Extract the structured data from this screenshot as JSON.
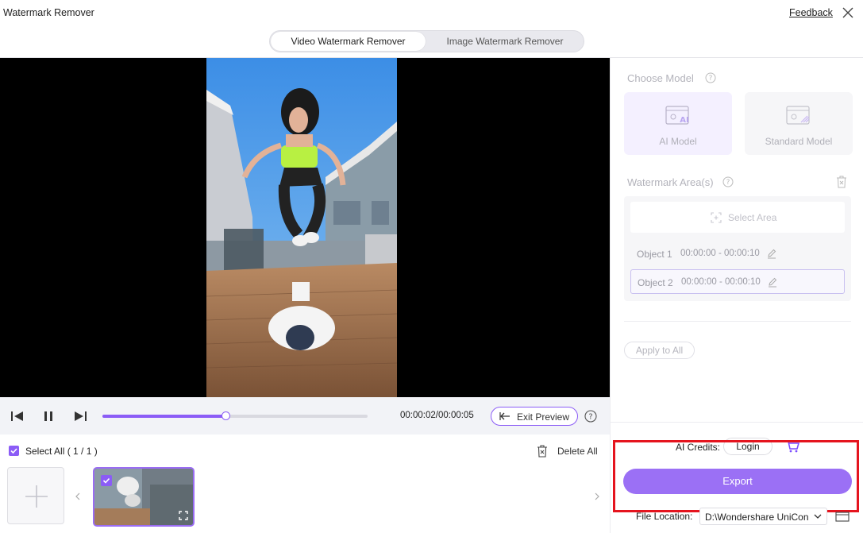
{
  "window": {
    "title": "Watermark Remover",
    "feedback_label": "Feedback"
  },
  "mode_tabs": [
    {
      "label": "Video Watermark Remover",
      "active": true
    },
    {
      "label": "Image Watermark Remover",
      "active": false
    }
  ],
  "player": {
    "time_current": "00:00:02",
    "time_total": "00:00:05",
    "time_readout": "00:00:02/00:00:05",
    "progress_fraction": 0.465,
    "exit_preview_label": "Exit Preview"
  },
  "media_strip": {
    "select_all_label": "Select All ( 1 / 1 )",
    "delete_all_label": "Delete All",
    "selected": true
  },
  "right_panel": {
    "choose_model_title": "Choose Model",
    "models": [
      {
        "label": "AI Model",
        "selected": true
      },
      {
        "label": "Standard Model",
        "selected": false
      }
    ],
    "watermark_area_title": "Watermark Area(s)",
    "select_area_label": "Select Area",
    "objects": [
      {
        "name": "Object 1",
        "range": "00:00:00 - 00:00:10"
      },
      {
        "name": "Object 2",
        "range": "00:00:00 - 00:00:10"
      }
    ],
    "apply_to_all_label": "Apply to All",
    "ai_credits_label": "AI Credits:",
    "login_label": "Login",
    "export_label": "Export",
    "file_location_label": "File Location:",
    "file_location_value": "D:\\Wondershare UniConverter"
  },
  "colors": {
    "accent": "#8b5cf6",
    "export_button": "#9b70f5",
    "highlight_box": "#e5141e"
  }
}
